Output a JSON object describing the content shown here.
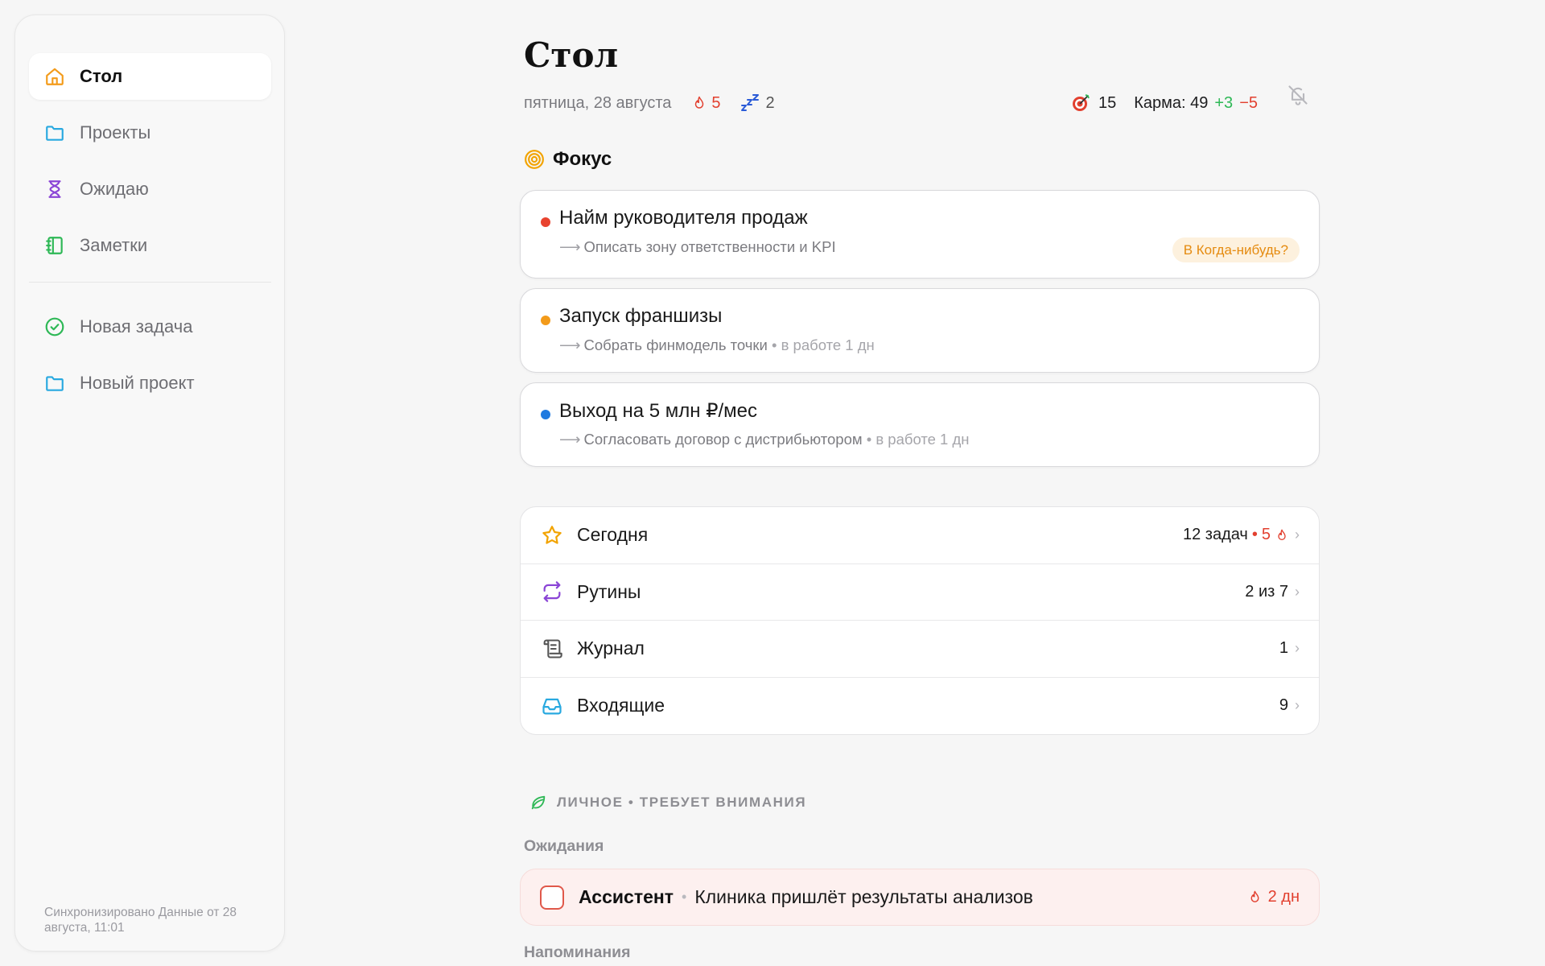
{
  "sidebar": {
    "nav": [
      {
        "label": "Стол",
        "icon": "home-icon",
        "active": true
      },
      {
        "label": "Проекты",
        "icon": "folder-icon"
      },
      {
        "label": "Ожидаю",
        "icon": "hourglass-icon"
      },
      {
        "label": "Заметки",
        "icon": "notebook-icon"
      }
    ],
    "actions": [
      {
        "label": "Новая задача",
        "icon": "check-circle-icon"
      },
      {
        "label": "Новый проект",
        "icon": "folder-icon"
      }
    ],
    "sync_note": "Синхронизировано Данные от 28 августа, 11:01"
  },
  "header": {
    "title": "Стол",
    "date": "пятница, 28 августа",
    "fire_count": "5",
    "sleep_count": "2",
    "target_count": "15",
    "karma_label": "Карма: 49",
    "karma_plus": "+3",
    "karma_minus": "−5"
  },
  "focus": {
    "title": "Фокус",
    "items": [
      {
        "title": "Найм руководителя продаж",
        "next": "Описать зону ответственности и KPI",
        "status": "",
        "badge": "В Когда-нибудь?",
        "dot_color": "#e8432f"
      },
      {
        "title": "Запуск франшизы",
        "next": "Собрать финмодель точки",
        "status": "• в работе 1 дн",
        "badge": "",
        "dot_color": "#f39b1a"
      },
      {
        "title": "Выход на 5 млн ₽/мес",
        "next": "Согласовать договор с дистрибьютором",
        "status": "• в работе 1 дн",
        "badge": "",
        "dot_color": "#1f7ae0"
      }
    ],
    "arrow": "⟶"
  },
  "lists": [
    {
      "label": "Сегодня",
      "icon": "star-icon",
      "count": "12 задач",
      "extra_sep": "•",
      "extra": "5"
    },
    {
      "label": "Рутины",
      "icon": "repeat-icon",
      "count": "2 из 7"
    },
    {
      "label": "Журнал",
      "icon": "scroll-icon",
      "count": "1"
    },
    {
      "label": "Входящие",
      "icon": "inbox-icon",
      "count": "9"
    }
  ],
  "personal": {
    "heading": "ЛИЧНОЕ • ТРЕБУЕТ ВНИМАНИЯ",
    "waiting_label": "Ожидания",
    "waiting_item": {
      "who": "Ассистент",
      "sep": "•",
      "what": "Клиника пришлёт результаты анализов",
      "due": "2 дн"
    },
    "reminders_label": "Напоминания"
  },
  "colors": {
    "accent_red": "#e2402f",
    "accent_green": "#2eb856",
    "accent_orange": "#f39b1a",
    "accent_blue": "#1f7ae0",
    "accent_purple": "#8b45d6"
  }
}
